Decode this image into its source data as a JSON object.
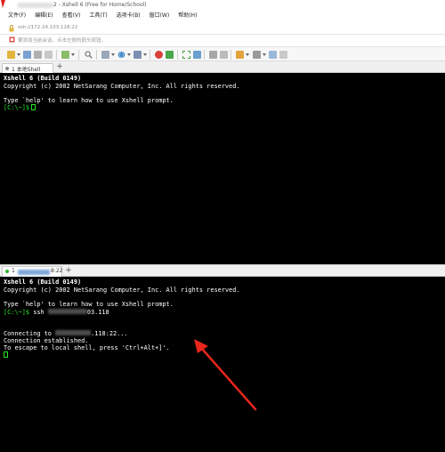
{
  "window": {
    "title": "2 - Xshell 6 (Free for Home/School)"
  },
  "menu": {
    "items": [
      "文件(F)",
      "编辑(E)",
      "查看(V)",
      "工具(T)",
      "选项卡(B)",
      "窗口(W)",
      "帮助(H)"
    ]
  },
  "address": {
    "value": "ssh://172.24.103.118:22"
  },
  "hint": {
    "text": "要添加当前会话，点击左侧的箭头按钮。"
  },
  "tabs_top": {
    "active_label": "1 本地Shell",
    "add_label": "+"
  },
  "terminal_top": {
    "line1": "Xshell 6 (Build 0149)",
    "line2": "Copyright (c) 2002 NetSarang Computer, Inc. All rights reserved.",
    "line3": "Type `help' to learn how to use Xshell prompt.",
    "prompt": "[C:\\~]$"
  },
  "tabs_bottom": {
    "number": "1",
    "suffix": "8:22",
    "add_label": "+"
  },
  "terminal_bottom": {
    "line1": "Xshell 6 (Build 0149)",
    "line2": "Copyright (c) 2002 NetSarang Computer, Inc. All rights reserved.",
    "line3": "Type `help' to learn how to use Xshell prompt.",
    "prompt": "[C:\\~]$",
    "cmd_prefix": "ssh",
    "cmd_suffix": "03.118",
    "connecting_prefix": "Connecting to",
    "connecting_suffix": ".118:22...",
    "established": "Connection established.",
    "escape": "To escape to local shell, press 'Ctrl+Alt+]'."
  },
  "colors": {
    "terminal_bg": "#000000",
    "terminal_fg": "#ffffff",
    "prompt_green": "#22e622",
    "annotation_red": "#e8261c"
  }
}
